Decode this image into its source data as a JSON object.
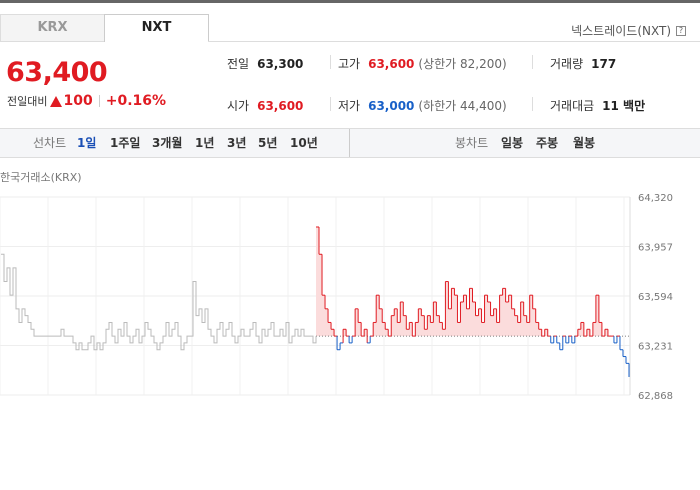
{
  "tabs": {
    "krx": "KRX",
    "nxt": "NXT"
  },
  "provider": {
    "label": "넥스트레이드(NXT)",
    "help": "?"
  },
  "quote": {
    "price": "63,400",
    "change_label": "전일대비",
    "change_abs": "100",
    "change_pct": "+0.16%"
  },
  "stats": {
    "prev_label": "전일",
    "prev": "63,300",
    "high_label": "고가",
    "high": "63,600",
    "upper_limit": "(상한가 82,200)",
    "volume_label": "거래량",
    "volume": "177",
    "open_label": "시가",
    "open": "63,600",
    "low_label": "저가",
    "low": "63,000",
    "lower_limit": "(하한가 44,400)",
    "value_label": "거래대금",
    "value": "11 백만"
  },
  "toolbar": {
    "line_label": "선차트",
    "periods": [
      "1일",
      "1주일",
      "3개월",
      "1년",
      "3년",
      "5년",
      "10년"
    ],
    "candle_label": "봉차트",
    "candles": [
      "일봉",
      "주봉",
      "월봉"
    ]
  },
  "exchange_label": "한국거래소(KRX)",
  "colors": {
    "up": "#e01b22",
    "down": "#1860c8",
    "muted": "#bbbbbb",
    "fill": "#fbdcdc"
  },
  "chart_data": {
    "type": "line",
    "ylim": [
      62868,
      64320
    ],
    "yticks": [
      "64,320",
      "63,957",
      "63,594",
      "63,231",
      "62,868"
    ],
    "baseline": 63300,
    "series": [
      {
        "values": [
          63900,
          63700,
          63800,
          63600,
          63800,
          63500,
          63400,
          63500,
          63450,
          63400,
          63350,
          63300,
          63300,
          63300,
          63300,
          63300,
          63300,
          63300,
          63300,
          63300,
          63350,
          63300,
          63300,
          63300,
          63250,
          63200,
          63250,
          63200,
          63200,
          63250,
          63300,
          63200,
          63250,
          63200,
          63250,
          63350,
          63400,
          63300,
          63250,
          63350,
          63300,
          63400,
          63300,
          63250,
          63300,
          63350,
          63250,
          63300,
          63400,
          63350,
          63300,
          63250,
          63200,
          63250,
          63300,
          63400,
          63300,
          63350,
          63400,
          63300,
          63200,
          63250,
          63300,
          63300,
          63700,
          63450,
          63500,
          63400,
          63500,
          63350,
          63300,
          63250,
          63350,
          63400,
          63300,
          63350,
          63400,
          63300,
          63250,
          63300,
          63350,
          63300,
          63300,
          63350,
          63400,
          63300,
          63250,
          63350,
          63300,
          63350,
          63400,
          63300,
          63300,
          63350,
          63300,
          63400,
          63250,
          63300,
          63350,
          63300,
          63350,
          63300,
          63300,
          63300,
          63250,
          63300
        ]
      },
      {
        "values": [
          64100,
          63900,
          63600,
          63500,
          63400,
          63350,
          63300,
          63200,
          63250,
          63350,
          63300,
          63250,
          63300,
          63500,
          63400,
          63300,
          63350,
          63250,
          63300,
          63400,
          63600,
          63500,
          63400,
          63350,
          63300,
          63450,
          63500,
          63400,
          63550,
          63450,
          63350,
          63400,
          63300,
          63400,
          63500,
          63450,
          63350,
          63450,
          63400,
          63550,
          63450,
          63400,
          63350,
          63700,
          63500,
          63650,
          63600,
          63400,
          63550,
          63600,
          63500,
          63650,
          63550,
          63450,
          63500,
          63400,
          63600,
          63550,
          63450,
          63500,
          63400,
          63600,
          63650,
          63550,
          63600,
          63500,
          63450,
          63400,
          63550,
          63450,
          63400,
          63600,
          63500,
          63400,
          63350,
          63300,
          63350,
          63300,
          63250,
          63300,
          63250,
          63200,
          63300,
          63250,
          63300,
          63250,
          63300,
          63350,
          63400,
          63300,
          63350,
          63300,
          63400,
          63600,
          63400,
          63300,
          63350,
          63300,
          63300,
          63250,
          63300,
          63200,
          63150,
          63100,
          63000
        ]
      }
    ]
  }
}
